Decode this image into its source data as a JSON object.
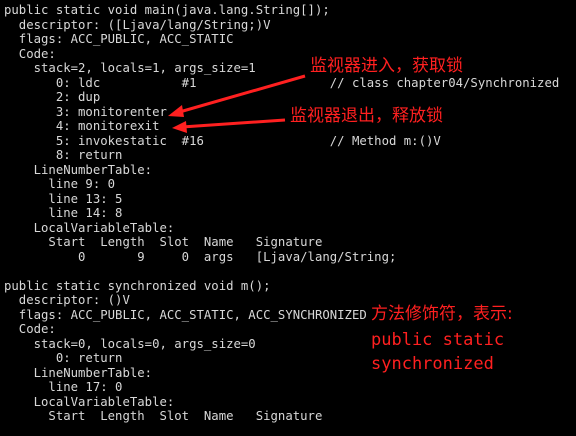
{
  "terminal": {
    "lines": [
      "public static void main(java.lang.String[]);",
      "  descriptor: ([Ljava/lang/String;)V",
      "  flags: ACC_PUBLIC, ACC_STATIC",
      "  Code:",
      "    stack=2, locals=1, args_size=1",
      "       0: ldc           #1                  // class chapter04/Synchronized",
      "       2: dup",
      "       3: monitorenter",
      "       4: monitorexit",
      "       5: invokestatic  #16                 // Method m:()V",
      "       8: return",
      "    LineNumberTable:",
      "      line 9: 0",
      "      line 13: 5",
      "      line 14: 8",
      "    LocalVariableTable:",
      "      Start  Length  Slot  Name   Signature",
      "          0       9     0  args   [Ljava/lang/String;",
      "",
      "public static synchronized void m();",
      "  descriptor: ()V",
      "  flags: ACC_PUBLIC, ACC_STATIC, ACC_SYNCHRONIZED",
      "  Code:",
      "    stack=0, locals=0, args_size=0",
      "       0: return",
      "    LineNumberTable:",
      "      line 17: 0",
      "    LocalVariableTable:",
      "      Start  Length  Slot  Name   Signature"
    ]
  },
  "annotations": {
    "monitor_enter": "监视器进入，获取锁",
    "monitor_exit": "监视器退出，释放锁",
    "modifier_title": "方法修饰符，表示:",
    "modifier_line1": "public static",
    "modifier_line2": "synchronized"
  },
  "colors": {
    "background": "#000000",
    "text": "#d8d8d8",
    "annotation": "#ff2020"
  }
}
